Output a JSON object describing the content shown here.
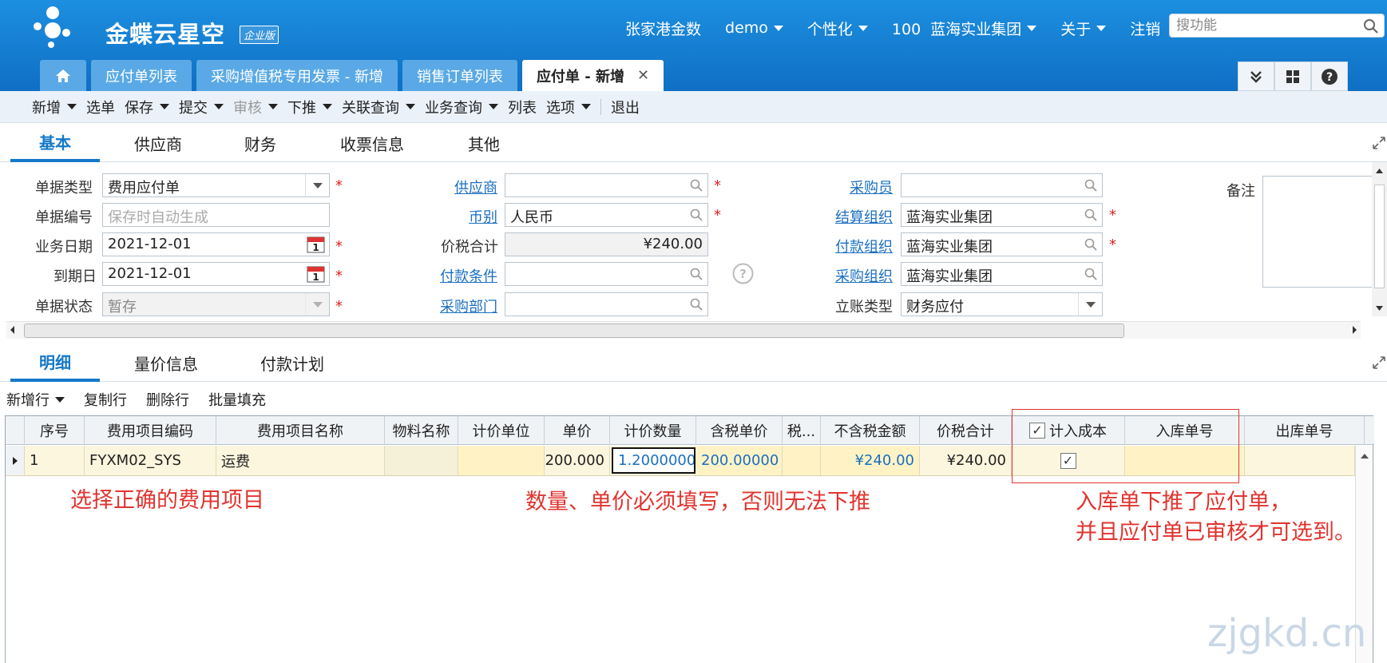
{
  "header": {
    "brand": "金蝶云星空",
    "edition_badge": "企业版",
    "nav": [
      {
        "label": "张家港金数",
        "dropdown": false
      },
      {
        "label": "demo",
        "dropdown": true
      },
      {
        "label": "个性化",
        "dropdown": true
      },
      {
        "label": "100  蓝海实业集团",
        "dropdown": true
      },
      {
        "label": "关于",
        "dropdown": true
      },
      {
        "label": "注销",
        "dropdown": false
      }
    ],
    "search_placeholder": "搜功能"
  },
  "tabs": [
    {
      "label": "应付单列表",
      "active": false
    },
    {
      "label": "采购增值税专用发票 - 新增",
      "active": false
    },
    {
      "label": "销售订单列表",
      "active": false
    },
    {
      "label": "应付单 - 新增",
      "active": true
    }
  ],
  "toolbar": [
    {
      "label": "新增",
      "dropdown": true
    },
    {
      "label": "选单",
      "dropdown": false
    },
    {
      "label": "保存",
      "dropdown": true
    },
    {
      "label": "提交",
      "dropdown": true
    },
    {
      "label": "审核",
      "dropdown": true,
      "disabled": true
    },
    {
      "label": "下推",
      "dropdown": true
    },
    {
      "label": "关联查询",
      "dropdown": true
    },
    {
      "label": "业务查询",
      "dropdown": true
    },
    {
      "label": "列表",
      "dropdown": false
    },
    {
      "label": "选项",
      "dropdown": true
    },
    {
      "label": "退出",
      "dropdown": false
    }
  ],
  "header_tabs": [
    "基本",
    "供应商",
    "财务",
    "收票信息",
    "其他"
  ],
  "form": {
    "doc_type": {
      "label": "单据类型",
      "value": "费用应付单"
    },
    "doc_no": {
      "label": "单据编号",
      "placeholder": "保存时自动生成"
    },
    "biz_date": {
      "label": "业务日期",
      "value": "2021-12-01"
    },
    "due_date": {
      "label": "到期日",
      "value": "2021-12-01"
    },
    "doc_status": {
      "label": "单据状态",
      "value": "暂存"
    },
    "supplier": {
      "label": "供应商",
      "value": ""
    },
    "currency": {
      "label": "币别",
      "value": "人民币"
    },
    "total": {
      "label": "价税合计",
      "value": "¥240.00"
    },
    "pay_terms": {
      "label": "付款条件",
      "value": ""
    },
    "purch_dept": {
      "label": "采购部门",
      "value": ""
    },
    "buyer": {
      "label": "采购员",
      "value": ""
    },
    "settle_org": {
      "label": "结算组织",
      "value": "蓝海实业集团"
    },
    "pay_org": {
      "label": "付款组织",
      "value": "蓝海实业集团"
    },
    "purch_org": {
      "label": "采购组织",
      "value": "蓝海实业集团"
    },
    "account_type": {
      "label": "立账类型",
      "value": "财务应付"
    },
    "remark": {
      "label": "备注"
    },
    "required_mark": "*",
    "calendar_day": "1"
  },
  "detail_tabs": [
    "明细",
    "量价信息",
    "付款计划"
  ],
  "grid_tools": [
    {
      "label": "新增行",
      "dropdown": true
    },
    {
      "label": "复制行",
      "dropdown": false
    },
    {
      "label": "删除行",
      "dropdown": false
    },
    {
      "label": "批量填充",
      "dropdown": false
    }
  ],
  "grid": {
    "columns": [
      "序号",
      "费用项目编码",
      "费用项目名称",
      "物料名称",
      "计价单位",
      "单价",
      "计价数量",
      "含税单价",
      "税...",
      "不含税金额",
      "价税合计",
      "计入成本",
      "入库单号",
      "出库单号"
    ],
    "rows": [
      {
        "seq": "1",
        "code": "FYXM02_SYS",
        "name": "运费",
        "material": "",
        "unit": "",
        "price": "200.000",
        "qty": "1.2000000",
        "tax_price": "200.00000",
        "tax": "",
        "amount_ex": "¥240.00",
        "total": "¥240.00",
        "include_cost": true,
        "in_no": "",
        "out_no": ""
      }
    ]
  },
  "annotations": {
    "a1": "选择正确的费用项目",
    "a2": "数量、单价必须填写，否则无法下推",
    "a3_line1": "入库单下推了应付单，",
    "a3_line2": "并且应付单已审核才可选到。"
  },
  "watermark": "zjgkd.cn",
  "colors": {
    "header": "#1a86da",
    "accent": "#1478c8",
    "annotation": "#e0342f",
    "row_highlight": "#fbf6dd"
  }
}
